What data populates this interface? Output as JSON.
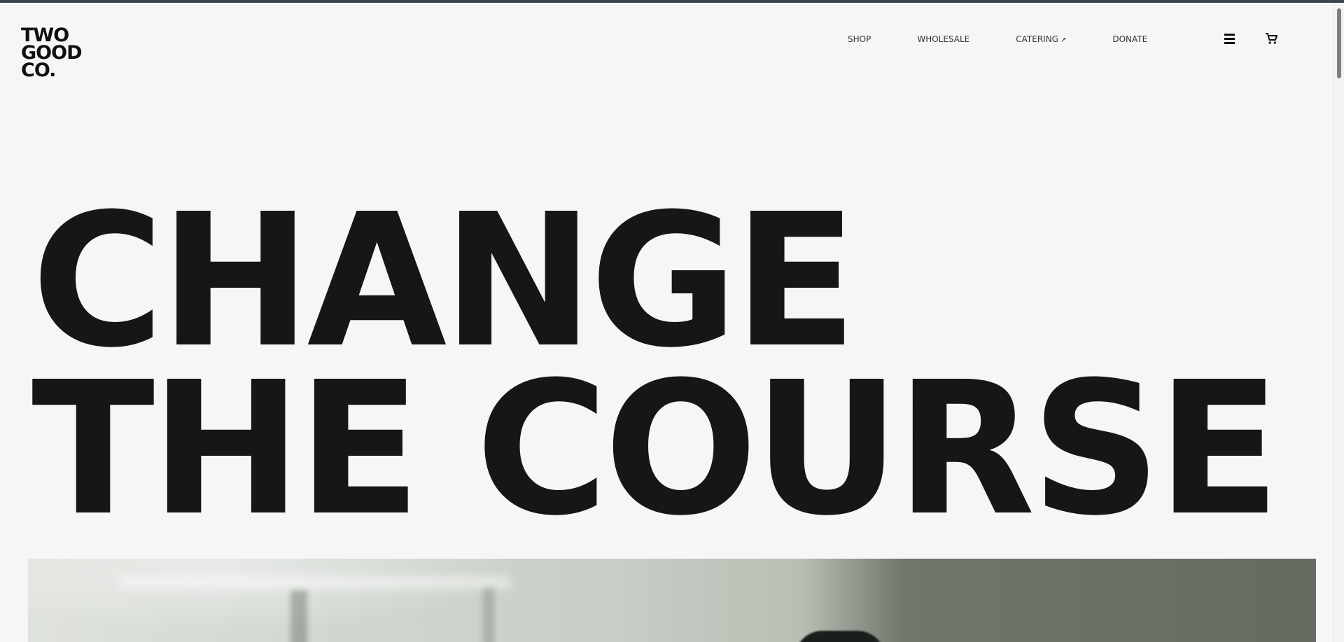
{
  "brand": {
    "logo_lines": [
      "TWO",
      "GOOD",
      "CO."
    ]
  },
  "nav": {
    "items": [
      {
        "label": "SHOP"
      },
      {
        "label": "WHOLESALE"
      },
      {
        "label": "CATERING",
        "external_icon": "↗"
      },
      {
        "label": "DONATE"
      }
    ]
  },
  "header_icons": {
    "menu": "menu-icon",
    "cart": "cart-icon"
  },
  "hero": {
    "headline_lines": [
      "CHANGE",
      "THE COURSE"
    ]
  },
  "colors": {
    "background": "#f6f6f6",
    "text": "#161616",
    "top_border": "#3d4350"
  }
}
